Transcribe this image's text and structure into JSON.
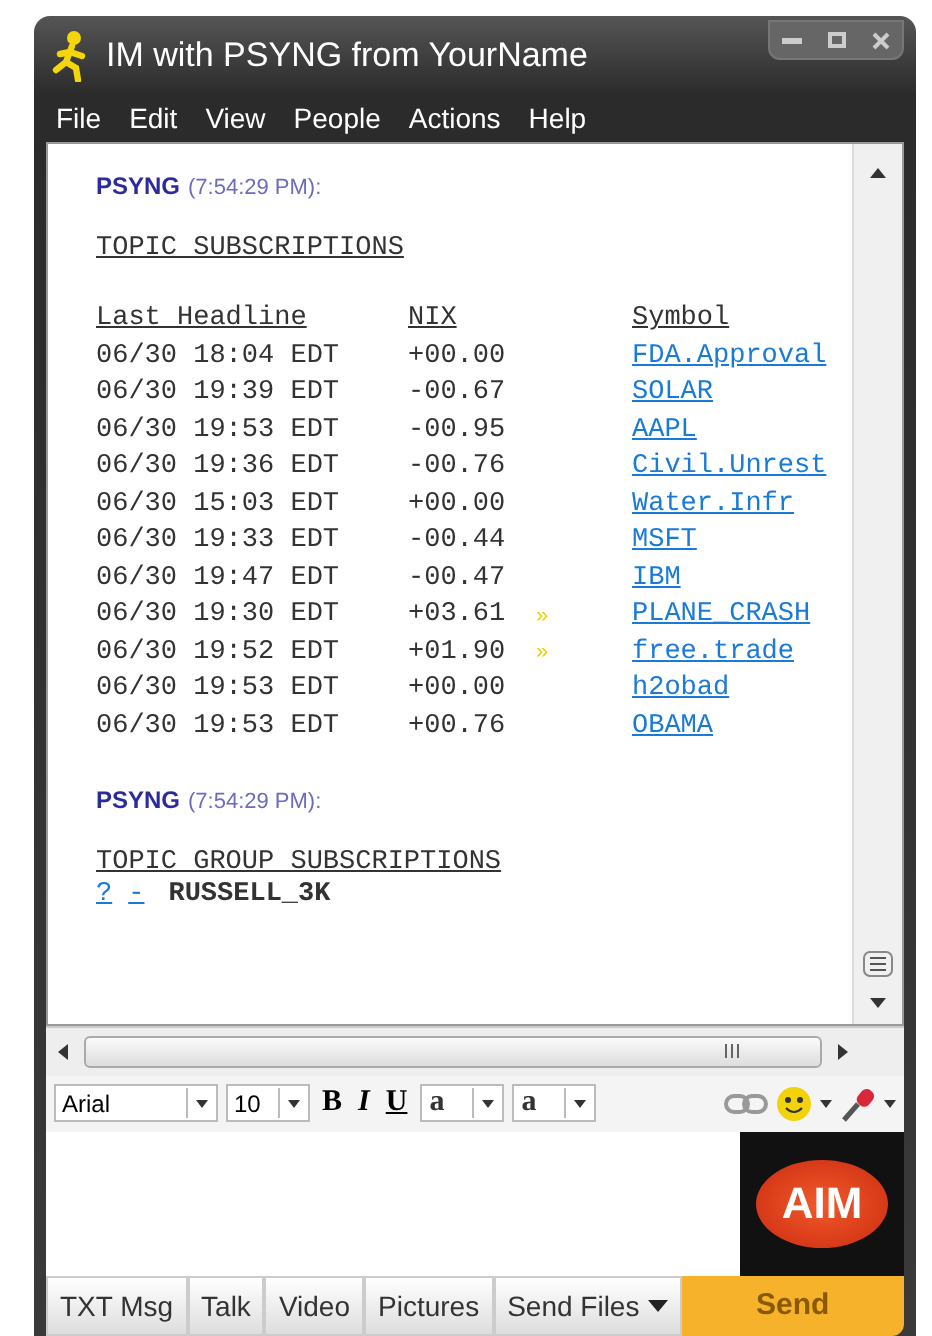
{
  "window": {
    "title": "IM with PSYNG from YourName"
  },
  "menu": [
    "File",
    "Edit",
    "View",
    "People",
    "Actions",
    "Help"
  ],
  "messages": [
    {
      "sender": "PSYNG",
      "time": "(7:54:29 PM):",
      "kind": "table",
      "heading": "TOPIC SUBSCRIPTIONS",
      "columns": [
        "Last Headline",
        "NIX",
        "Symbol"
      ],
      "rows": [
        {
          "date": "06/30 18:04 EDT",
          "nix": "+00.00",
          "symbol": "FDA.Approval"
        },
        {
          "date": "06/30 19:39 EDT",
          "nix": "-00.67",
          "symbol": "SOLAR"
        },
        {
          "date": "06/30 19:53 EDT",
          "nix": "-00.95",
          "symbol": "AAPL"
        },
        {
          "date": "06/30 19:36 EDT",
          "nix": "-00.76",
          "symbol": "Civil.Unrest"
        },
        {
          "date": "06/30 15:03 EDT",
          "nix": "+00.00",
          "symbol": "Water.Infr"
        },
        {
          "date": "06/30 19:33 EDT",
          "nix": "-00.44",
          "symbol": "MSFT"
        },
        {
          "date": "06/30 19:47 EDT",
          "nix": "-00.47",
          "symbol": "IBM"
        },
        {
          "date": "06/30 19:30 EDT",
          "nix": "+03.61",
          "marker": "»",
          "symbol": "PLANE_CRASH"
        },
        {
          "date": "06/30 19:52 EDT",
          "nix": "+01.90",
          "marker": "»",
          "symbol": "free.trade"
        },
        {
          "date": "06/30 19:53 EDT",
          "nix": "+00.00",
          "symbol": "h2obad"
        },
        {
          "date": "06/30 19:53 EDT",
          "nix": "+00.76",
          "symbol": "OBAMA"
        }
      ]
    },
    {
      "sender": "PSYNG",
      "time": "(7:54:29 PM):",
      "kind": "group",
      "heading": "TOPIC GROUP SUBSCRIPTIONS",
      "links": [
        "?",
        "-"
      ],
      "group": "RUSSELL_3K"
    }
  ],
  "format_bar": {
    "font": "Arial",
    "size": "10",
    "bold": "B",
    "italic": "I",
    "underline": "U",
    "text_color": "a",
    "highlight": "a"
  },
  "logo": "AIM",
  "buttons": [
    "TXT Msg",
    "Talk",
    "Video",
    "Pictures",
    "Send Files"
  ],
  "send": "Send"
}
